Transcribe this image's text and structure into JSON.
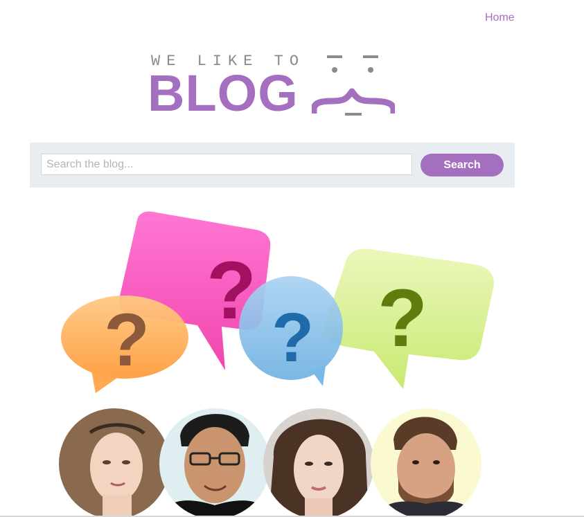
{
  "nav": {
    "home_label": "Home"
  },
  "logo": {
    "tagline": "WE LIKE TO",
    "word": "BLOG"
  },
  "search": {
    "placeholder": "Search the blog...",
    "value": "",
    "button_label": "Search"
  },
  "hero": {
    "bubbles": [
      {
        "color": "#ffb866",
        "mark": "?"
      },
      {
        "color": "#ff5ec4",
        "mark": "?"
      },
      {
        "color": "#8fc3ec",
        "mark": "?"
      },
      {
        "color": "#d6f08c",
        "mark": "?"
      }
    ],
    "people_count_shown": "4"
  },
  "colors": {
    "accent": "#a56fc0",
    "logo_gray": "#8a8a8a",
    "search_bg": "#e8edf1"
  }
}
